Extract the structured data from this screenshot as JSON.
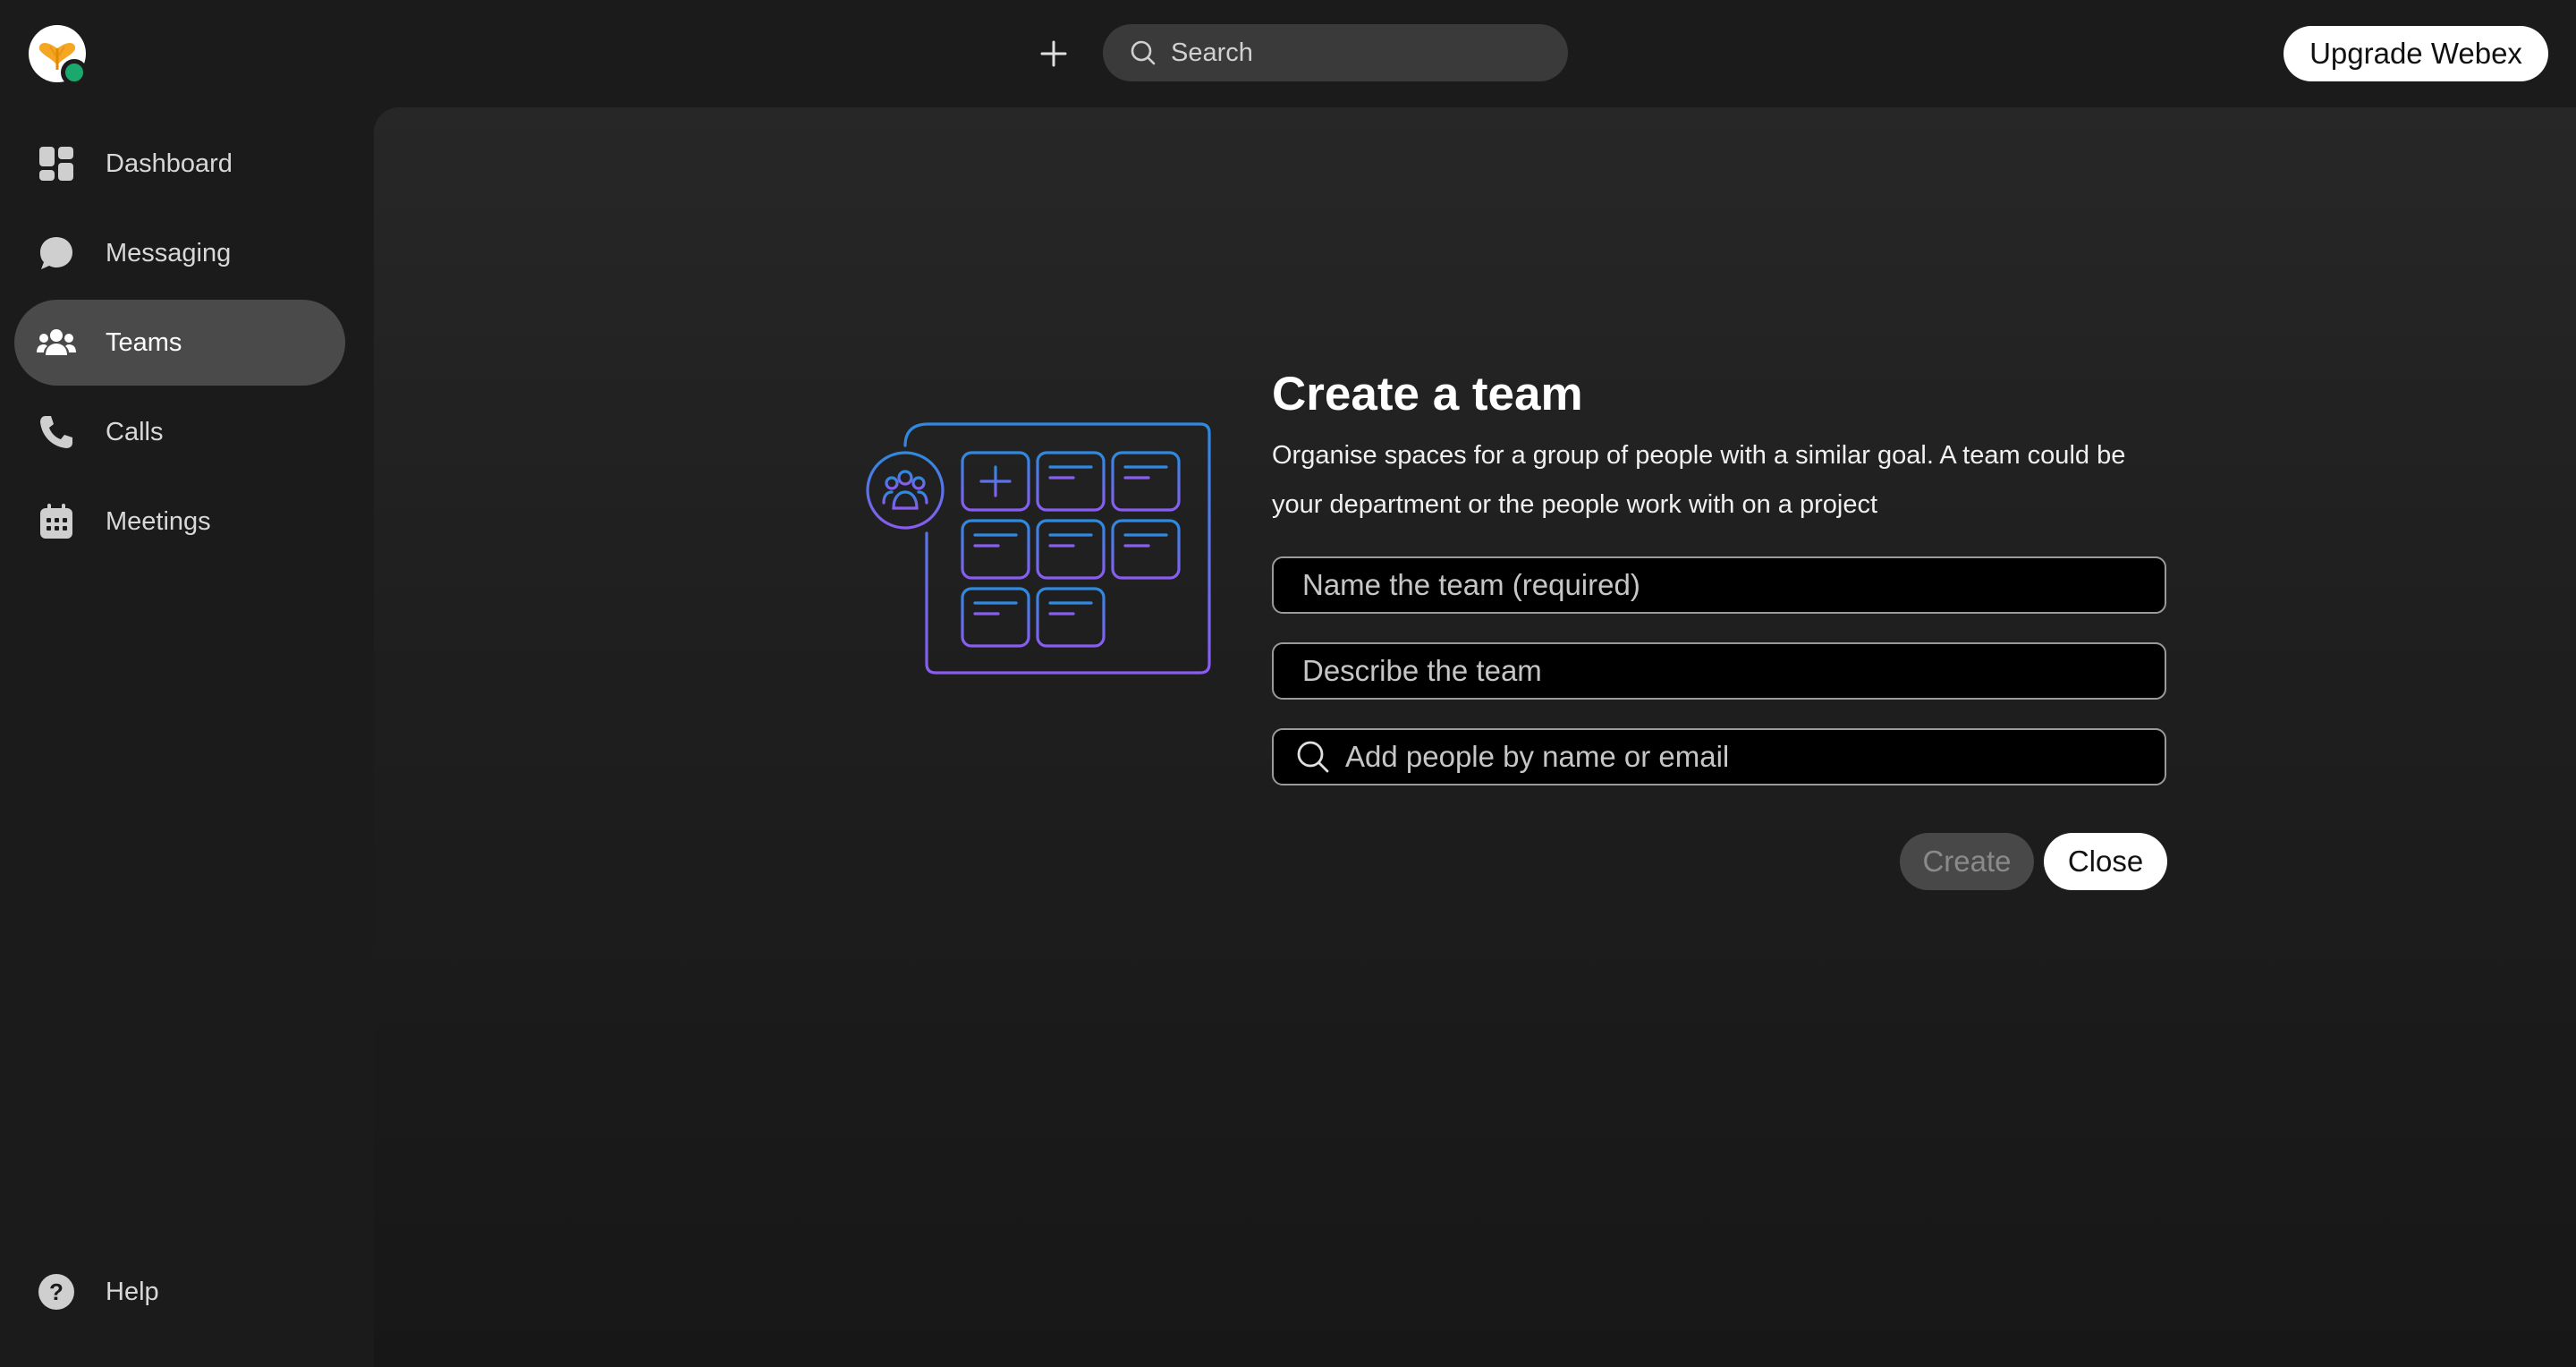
{
  "topbar": {
    "search_label": "Search",
    "upgrade_label": "Upgrade Webex",
    "avatar_status": "available"
  },
  "sidebar": {
    "items": [
      {
        "label": "Dashboard",
        "icon": "dashboard-icon"
      },
      {
        "label": "Messaging",
        "icon": "chat-bubble-icon"
      },
      {
        "label": "Teams",
        "icon": "people-group-icon",
        "active": true
      },
      {
        "label": "Calls",
        "icon": "phone-icon"
      },
      {
        "label": "Meetings",
        "icon": "calendar-icon"
      }
    ],
    "help_label": "Help"
  },
  "create_team": {
    "title": "Create a team",
    "description": "Organise spaces for a group of people with a similar goal. A team could be your department or the people work with on a project",
    "name_placeholder": "Name the team (required)",
    "describe_placeholder": "Describe the team",
    "people_placeholder": "Add people by name or email",
    "create_label": "Create",
    "close_label": "Close"
  },
  "colors": {
    "accent_blue": "#2d8ae0",
    "accent_purple": "#8a5cf0",
    "presence_green": "#1aa86d",
    "background": "#1b1b1b"
  }
}
